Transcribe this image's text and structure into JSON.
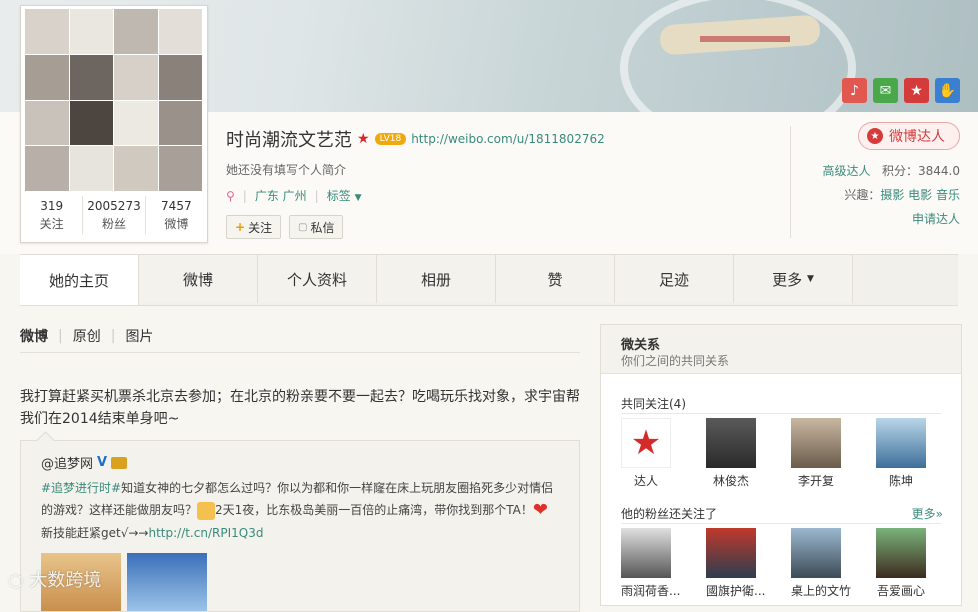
{
  "banner": {
    "icons": [
      {
        "name": "microphone-icon",
        "glyph": "🎤",
        "color": "#e0584f"
      },
      {
        "name": "chat-icon",
        "glyph": "✉",
        "color": "#4aa84a"
      },
      {
        "name": "star-icon",
        "glyph": "★",
        "color": "#d43c3c"
      },
      {
        "name": "hand-icon",
        "glyph": "✋",
        "color": "#3a7fd0"
      }
    ]
  },
  "profile": {
    "name": "时尚潮流文艺范",
    "level_badge": "LV18",
    "url": "http://weibo.com/u/1811802762",
    "intro": "她还没有填写个人简介",
    "location": "广东 广州",
    "tags_label": "标签",
    "follow_label": "关注",
    "message_label": "私信",
    "stats": [
      {
        "num": "319",
        "label": "关注"
      },
      {
        "num": "2005273",
        "label": "粉丝"
      },
      {
        "num": "7457",
        "label": "微博"
      }
    ]
  },
  "right_info": {
    "vip_label": "微博达人",
    "level_label": "高级达人",
    "points_label": "积分：",
    "points_value": "3844.0",
    "interest_label": "兴趣：",
    "interests": "摄影 电影 音乐",
    "apply_label": "申请达人"
  },
  "nav": {
    "tabs": [
      "她的主页",
      "微博",
      "个人资料",
      "相册",
      "赞",
      "足迹",
      "更多"
    ]
  },
  "feed": {
    "subtabs": [
      "微博",
      "原创",
      "图片"
    ],
    "post_text": "我打算赶紧买机票杀北京去参加；在北京的粉亲要不要一起去？吃喝玩乐找对象，求宇宙帮我们在2014结束单身吧~",
    "repost": {
      "author": "@追梦网",
      "topic": "#追梦进行时#",
      "text1": "知道女神的七夕都怎么过吗？你以为都和你一样窿在床上玩朋友圈掐死多少对情侣的游戏？这样还能做朋友吗？",
      "text2": "2天1夜，比东极岛美丽一百倍的止痛湾，带你找到那个TA！",
      "text3": "新技能赶紧get√→→",
      "link": "http://t.cn/RPI1Q3d"
    }
  },
  "watermark": "大数跨境",
  "sidebar": {
    "title": "微关系",
    "subtitle": "你们之间的共同关系",
    "common_title": "共同关注(4)",
    "common_users": [
      "达人",
      "林俊杰",
      "李开复",
      "陈坤"
    ],
    "fans_title": "他的粉丝还关注了",
    "more_label": "更多»",
    "fans_users": [
      "雨润荷香...",
      "國旗护衛...",
      "桌上的文竹",
      "吾爱画心"
    ]
  }
}
